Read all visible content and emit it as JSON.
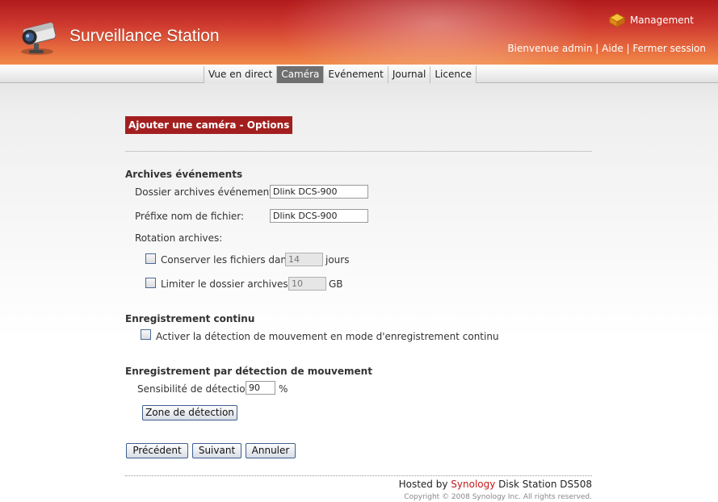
{
  "header": {
    "title": "Surveillance Station",
    "management_label": "Management",
    "welcome": "Bienvenue admin",
    "help": "Aide",
    "logout": "Fermer session",
    "separator": "|"
  },
  "tabs": [
    {
      "label": "Vue en direct",
      "active": false
    },
    {
      "label": "Caméra",
      "active": true
    },
    {
      "label": "Evénement",
      "active": false
    },
    {
      "label": "Journal",
      "active": false
    },
    {
      "label": "Licence",
      "active": false
    }
  ],
  "page_heading": "Ajouter une caméra - Options",
  "archives": {
    "section_title": "Archives événements",
    "folder_label": "Dossier archives événements:",
    "folder_value": "Dlink DCS-900",
    "prefix_label": "Préfixe nom de fichier:",
    "prefix_value": "Dlink DCS-900",
    "rotation_label": "Rotation archives:",
    "keep_files_label": "Conserver les fichiers dans",
    "keep_files_value": "14",
    "keep_files_unit": "jours",
    "keep_files_checked": false,
    "limit_label": "Limiter le dossier archives à",
    "limit_value": "10",
    "limit_unit": "GB",
    "limit_checked": false
  },
  "continuous": {
    "section_title": "Enregistrement continu",
    "motion_in_continuous_label": "Activer la détection de mouvement en mode d'enregistrement continu",
    "checked": false
  },
  "motion": {
    "section_title": "Enregistrement par détection de mouvement",
    "sensitivity_label": "Sensibilité de détection:",
    "sensitivity_value": "90",
    "sensitivity_unit": "%",
    "zone_button": "Zone de détection"
  },
  "buttons": {
    "previous": "Précédent",
    "next": "Suivant",
    "cancel": "Annuler"
  },
  "footer": {
    "hosted_prefix": "Hosted by",
    "brand": "Synology",
    "hosted_suffix": "Disk Station DS508",
    "copyright": "Copyright © 2008 Synology Inc. All rights reserved."
  },
  "colors": {
    "header_red": "#b21a1c",
    "header_orange": "#f08a49",
    "heading_bg": "#a31f1f",
    "active_tab": "#6f6f6f",
    "brand_red": "#c41818"
  }
}
